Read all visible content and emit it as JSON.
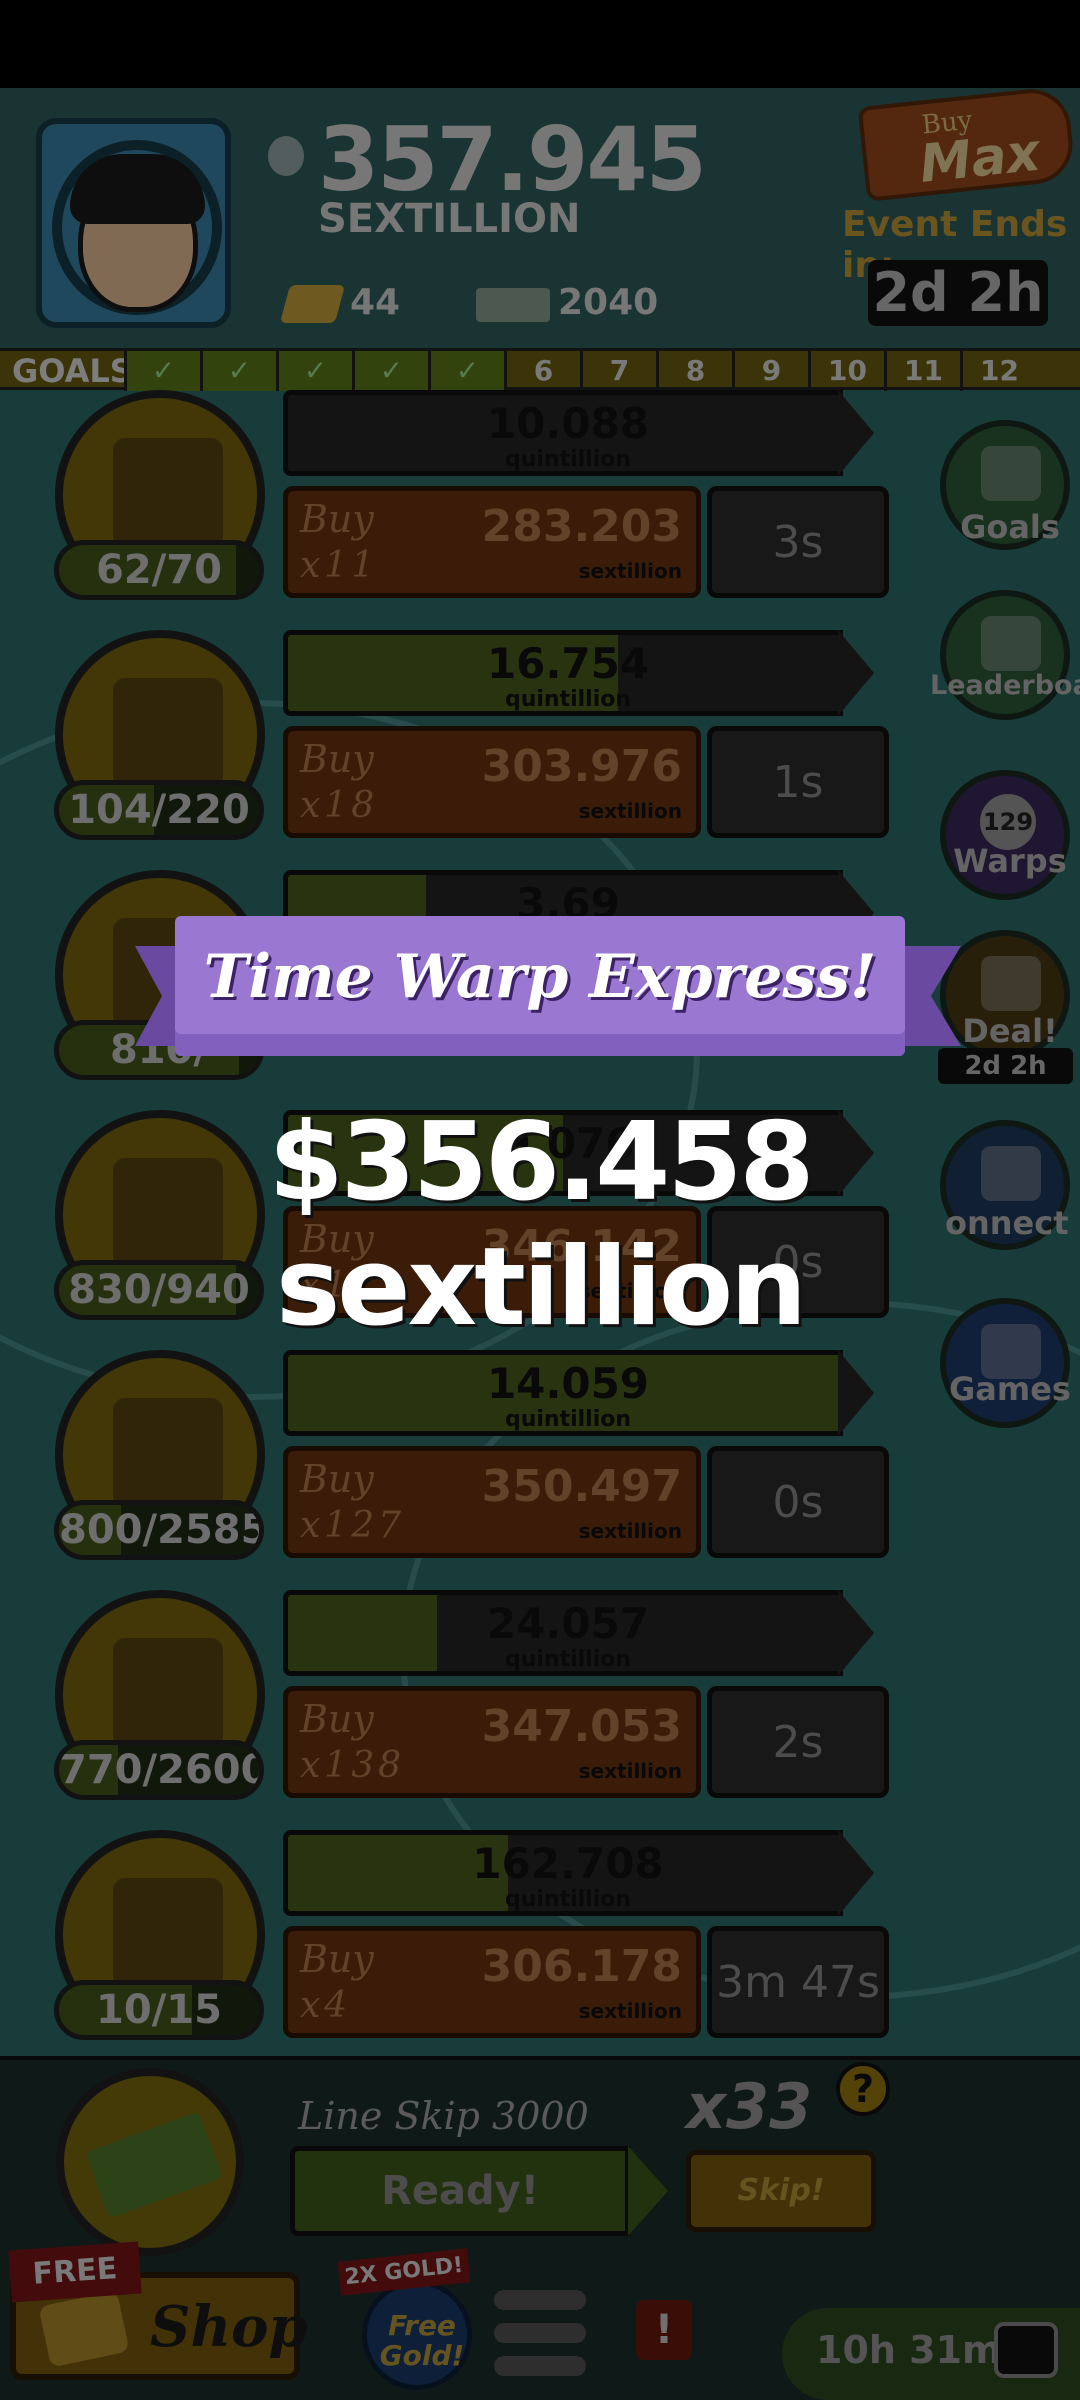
{
  "header": {
    "money_value": "357.945",
    "money_unit": "SEXTILLION",
    "gold": "44",
    "bills": "2040",
    "buy_max_small": "Buy",
    "buy_max_label": "Max",
    "event_label": "Event Ends in:",
    "event_time": "2d 2h"
  },
  "goals": {
    "label": "GOALS",
    "completed": 5,
    "steps": [
      "6",
      "7",
      "8",
      "9",
      "10",
      "11",
      "12"
    ]
  },
  "businesses": [
    {
      "count": "62/70",
      "count_fraction": 0.886,
      "progress_value": "10.088",
      "progress_unit": "quintillion",
      "progress_fraction": 0.0,
      "buy_label": "Buy",
      "buy_qty": "x11",
      "price": "283.203",
      "price_unit": "sextillion",
      "timer": "3s"
    },
    {
      "count": "104/220",
      "count_fraction": 0.473,
      "progress_value": "16.754",
      "progress_unit": "quintillion",
      "progress_fraction": 0.6,
      "buy_label": "Buy",
      "buy_qty": "x18",
      "price": "303.976",
      "price_unit": "sextillion",
      "timer": "1s"
    },
    {
      "count": "810/",
      "count_fraction": 0.9,
      "progress_value": "3.69",
      "progress_unit": "",
      "progress_fraction": 0.25,
      "buy_label": "",
      "buy_qty": "",
      "price": "",
      "price_unit": "",
      "timer": ""
    },
    {
      "count": "830/940",
      "count_fraction": 0.883,
      "progress_value": "9.076",
      "progress_unit": "",
      "progress_fraction": 0.5,
      "buy_label": "Buy",
      "buy_qty": "x111",
      "price": "346.142",
      "price_unit": "sextillion",
      "timer": "0s"
    },
    {
      "count": "800/2585",
      "count_fraction": 0.309,
      "progress_value": "14.059",
      "progress_unit": "quintillion",
      "progress_fraction": 1.0,
      "buy_label": "Buy",
      "buy_qty": "x127",
      "price": "350.497",
      "price_unit": "sextillion",
      "timer": "0s"
    },
    {
      "count": "770/2600",
      "count_fraction": 0.296,
      "progress_value": "24.057",
      "progress_unit": "quintillion",
      "progress_fraction": 0.27,
      "buy_label": "Buy",
      "buy_qty": "x138",
      "price": "347.053",
      "price_unit": "sextillion",
      "timer": "2s"
    },
    {
      "count": "10/15",
      "count_fraction": 0.667,
      "progress_value": "162.708",
      "progress_unit": "quintillion",
      "progress_fraction": 0.4,
      "buy_label": "Buy",
      "buy_qty": "x4",
      "price": "306.178",
      "price_unit": "sextillion",
      "timer": "3m 47s"
    }
  ],
  "side_menu": {
    "goals": "Goals",
    "leaderboard": "Leaderboard",
    "warps": "Warps",
    "warps_count": "129",
    "deal": "Deal!",
    "deal_time": "2d 2h",
    "connect": "onnect",
    "games": "Games"
  },
  "line_skip": {
    "title": "Line Skip 3000",
    "status": "Ready!",
    "multiplier": "x33",
    "help": "?",
    "skip_label": "Skip!"
  },
  "bottom_bar": {
    "free_tag": "FREE",
    "shop_label": "Shop",
    "gold_tag": "2X GOLD!",
    "gold_label": "Free Gold!",
    "alert": "!",
    "timer": "10h 31m"
  },
  "event_popup": {
    "title": "Time Warp Express!",
    "reward": "$356.458 sextillion"
  },
  "colors": {
    "banner_purple": "#9a78d2",
    "buy_orange": "#6a3411",
    "progress_green": "#4a5d1c"
  }
}
